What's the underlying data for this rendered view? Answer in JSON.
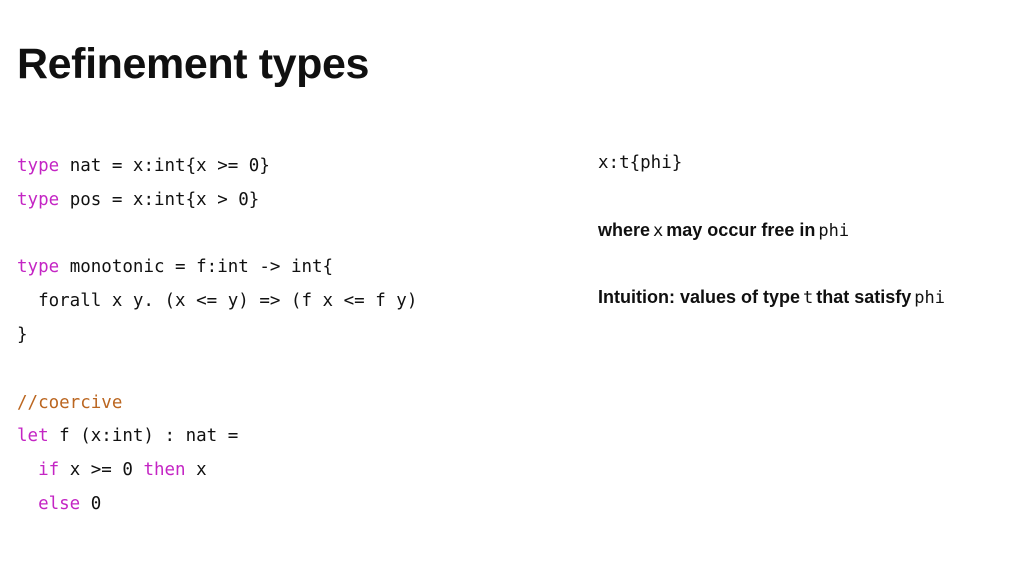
{
  "slide": {
    "title": "Refinement types",
    "background_color": "#ffffff",
    "keyword_color": "#c425c4",
    "comment_color": "#bb6620",
    "text_color": "#101010"
  },
  "code": {
    "lines": [
      {
        "id": "type-nat",
        "segments": [
          {
            "text": "type",
            "style": "keyword"
          },
          {
            "text": " nat = x:int{x >= 0}",
            "style": "plain"
          }
        ],
        "plain": "type nat = x:int{x >= 0}"
      },
      {
        "id": "type-pos",
        "segments": [
          {
            "text": "type",
            "style": "keyword"
          },
          {
            "text": " pos = x:int{x > 0}",
            "style": "plain"
          }
        ],
        "plain": "type pos = x:int{x > 0}"
      },
      {
        "id": "blank-1",
        "segments": [],
        "plain": ""
      },
      {
        "id": "type-monotonic",
        "segments": [
          {
            "text": "type",
            "style": "keyword"
          },
          {
            "text": " monotonic = f:int -> int{",
            "style": "plain"
          }
        ],
        "plain": "type monotonic = f:int -> int{"
      },
      {
        "id": "monotonic-body",
        "segments": [
          {
            "text": "  forall x y. (x <= y) => (f x <= f y)",
            "style": "plain"
          }
        ],
        "plain": "  forall x y. (x <= y) => (f x <= f y)"
      },
      {
        "id": "monotonic-close",
        "segments": [
          {
            "text": "}",
            "style": "plain"
          }
        ],
        "plain": "}"
      },
      {
        "id": "blank-2",
        "segments": [],
        "plain": ""
      },
      {
        "id": "comment-coercive",
        "segments": [
          {
            "text": "//coercive",
            "style": "comment"
          }
        ],
        "plain": "//coercive"
      },
      {
        "id": "let-f",
        "segments": [
          {
            "text": "let",
            "style": "keyword"
          },
          {
            "text": " f (x:int) : nat =",
            "style": "plain"
          }
        ],
        "plain": "let f (x:int) : nat ="
      },
      {
        "id": "if-branch",
        "segments": [
          {
            "text": "  ",
            "style": "plain"
          },
          {
            "text": "if",
            "style": "keyword"
          },
          {
            "text": " x >= 0 ",
            "style": "plain"
          },
          {
            "text": "then",
            "style": "keyword"
          },
          {
            "text": " x",
            "style": "plain"
          }
        ],
        "plain": "  if x >= 0 then x"
      },
      {
        "id": "else-branch",
        "segments": [
          {
            "text": "  ",
            "style": "plain"
          },
          {
            "text": "else",
            "style": "keyword"
          },
          {
            "text": " 0",
            "style": "plain"
          }
        ],
        "plain": "  else 0"
      }
    ]
  },
  "notes": {
    "refinement_form": "x:t{phi}",
    "scope_note": {
      "before": "where",
      "var": "x",
      "middle": "may occur free in",
      "predicate": "phi"
    },
    "intuition_note": {
      "before": "Intuition: values of type",
      "type_var": "t",
      "middle": "that satisfy",
      "predicate": "phi"
    }
  }
}
